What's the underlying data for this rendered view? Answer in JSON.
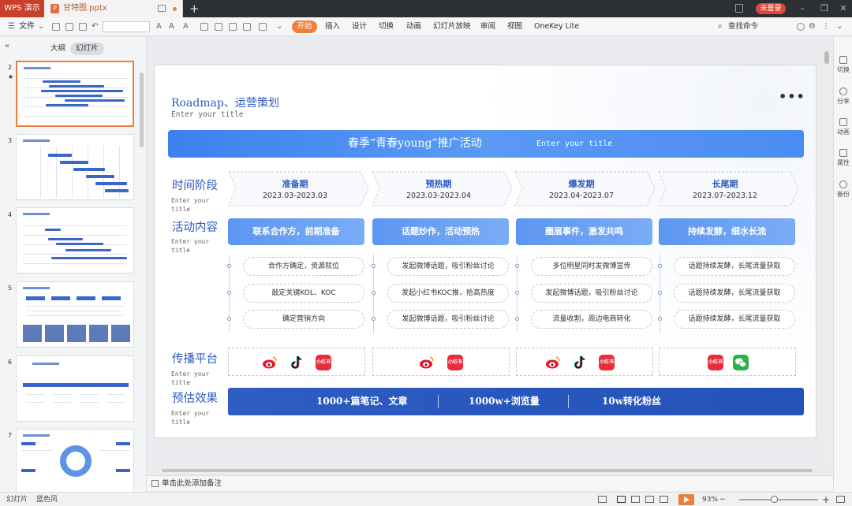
{
  "titlebar": {
    "app_name": "WPS 演示",
    "doc_name": "甘特图.pptx",
    "new_tab": "+",
    "login": "未登录"
  },
  "ribbon": {
    "file": "文件",
    "tabs": [
      "开始",
      "插入",
      "设计",
      "切换",
      "动画",
      "幻灯片放映",
      "审阅",
      "视图",
      "OneKey Lite"
    ],
    "search": "查找命令"
  },
  "left_pane": {
    "tabs": [
      "大纲",
      "幻灯片"
    ],
    "slide_numbers": [
      "2",
      "3",
      "4",
      "5",
      "6",
      "7"
    ],
    "star": "★"
  },
  "slide": {
    "title": "Roadmap、运营策划",
    "subtitle": "Enter your title",
    "more": "•••",
    "banner_main": "春季“青春young”推广活动",
    "banner_sub": "Enter your title",
    "rows": [
      {
        "label": "时间阶段",
        "sub": "Enter your title"
      },
      {
        "label": "活动内容",
        "sub": "Enter your title"
      },
      {
        "label": "传播平台",
        "sub": "Enter your title"
      },
      {
        "label": "预估效果",
        "sub": "Enter your title"
      }
    ],
    "phases": [
      {
        "name": "准备期",
        "date": "2023.03-2023.03"
      },
      {
        "name": "预热期",
        "date": "2023.03-2023.04"
      },
      {
        "name": "爆发期",
        "date": "2023.04-2023.07"
      },
      {
        "name": "长尾期",
        "date": "2023.07-2023.12"
      }
    ],
    "activities": [
      "联系合作方，前期准备",
      "话题炒作，活动预热",
      "圈层事件，激发共鸣",
      "持续发酵，细水长流"
    ],
    "items": [
      [
        "合作方确定，资源就位",
        "敲定关键KOL、KOC",
        "确定营销方向"
      ],
      [
        "发起微博话题，吸引粉丝讨论",
        "发起小红书KOC推，拾高热度",
        "发起微博话题，吸引粉丝讨论"
      ],
      [
        "多位明星同时发微博宣传",
        "发起微博话题，吸引粉丝讨论",
        "流量收割，周边电商转化"
      ],
      [
        "话题持续发酵，长尾流量获取",
        "话题持续发酵，长尾流量获取",
        "话题持续发酵，长尾流量获取"
      ]
    ],
    "platform_icons": [
      [
        "weibo-icon",
        "douyin-icon",
        "xiaohongshu-icon"
      ],
      [
        "weibo-icon",
        "xiaohongshu-icon"
      ],
      [
        "weibo-icon",
        "douyin-icon",
        "xiaohongshu-icon"
      ],
      [
        "xiaohongshu-icon",
        "wechat-icon"
      ]
    ],
    "xhs_label": "小红书",
    "stats": [
      "1000+篇笔记、文章",
      "1000w+浏览量",
      "10w转化粉丝"
    ]
  },
  "right_bar": [
    "切换",
    "分享",
    "动画",
    "属性",
    "备份"
  ],
  "notes": {
    "placeholder": "单击此处添加备注"
  },
  "status": {
    "slide_label": "幻灯片",
    "theme": "蓝色风",
    "zoom": "93%",
    "minus": "−",
    "plus": "+"
  },
  "colors": {
    "accent": "#f07e3b",
    "brand_blue": "#2b59c3",
    "banner_blue": "#4b8cf2",
    "stat_blue": "#2352b8"
  }
}
